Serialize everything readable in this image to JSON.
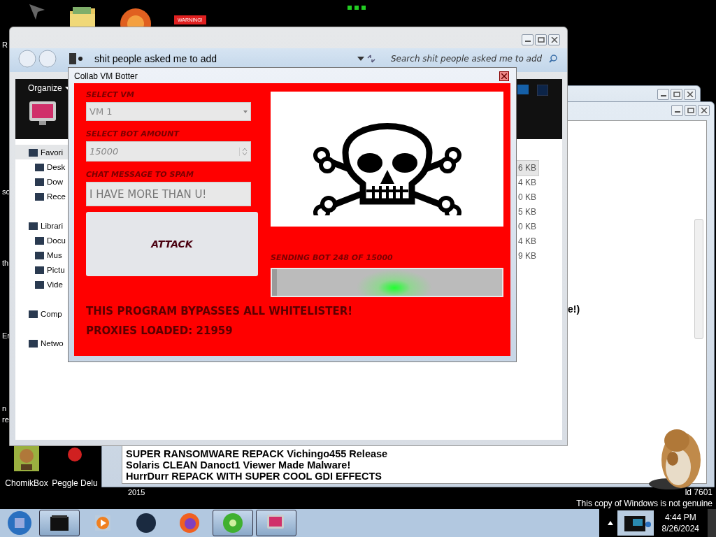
{
  "desktop": {
    "warning_label": "WARNING!",
    "edge_labels": [
      "R",
      "so",
      "th",
      "Er",
      "n",
      "re"
    ],
    "bottom_icons": [
      {
        "label": "ChomikBox",
        "kind": "box"
      },
      {
        "label": "Peggle Delu",
        "kind": "ball"
      }
    ],
    "year_label": "2015",
    "build_label": "ld 7601",
    "genuine_notice": "This copy of Windows is not genuine"
  },
  "back_window": {
    "partial_text": "e!)",
    "lines": [
      "SUPER RANSOMWARE REPACK Vichingo455 Release",
      "Solaris CLEAN Danoct1 Viewer Made Malware!",
      "HurrDurr REPACK WITH SUPER COOL GDI EFFECTS"
    ]
  },
  "explorer": {
    "address": "shit people asked me to add",
    "search_placeholder": "Search shit people asked me to add",
    "organize": "Organize",
    "nav": [
      {
        "label": "Favori",
        "selected": true,
        "children": [
          {
            "label": "Desk",
            "selected": false
          },
          {
            "label": "Dow",
            "selected": false
          },
          {
            "label": "Rece",
            "selected": false
          }
        ]
      },
      {
        "label": "Librari",
        "selected": false,
        "children": [
          {
            "label": "Docu",
            "selected": false
          },
          {
            "label": "Mus",
            "selected": false
          },
          {
            "label": "Pictu",
            "selected": false
          },
          {
            "label": "Vide",
            "selected": false
          }
        ]
      },
      {
        "label": "Comp",
        "selected": false
      },
      {
        "label": "Netwo",
        "selected": false
      }
    ],
    "sizes": [
      {
        "text": "6 KB",
        "selected": true
      },
      {
        "text": "4 KB",
        "selected": false
      },
      {
        "text": "0 KB",
        "selected": false
      },
      {
        "text": "5 KB",
        "selected": false
      },
      {
        "text": "0 KB",
        "selected": false
      },
      {
        "text": "4 KB",
        "selected": false
      },
      {
        "text": "9 KB",
        "selected": false
      }
    ]
  },
  "dialog": {
    "title": "Collab VM Botter",
    "vm_label": "SELECT VM",
    "vm_value": "VM 1",
    "amount_label": "SELECT BOT AMOUNT",
    "amount_value": "15000",
    "message_label": "CHAT MESSAGE TO SPAM",
    "message_value": "I HAVE MORE THAN U!",
    "attack": "ATTACK",
    "status": "SENDING BOT 248 OF 15000",
    "progress": {
      "level": 0.02
    },
    "note": "THIS PROGRAM BYPASSES ALL WHITELISTER!",
    "proxies": "PROXIES LOADED: 21959"
  },
  "taskbar": {
    "items": [
      {
        "kind": "box",
        "active": true
      },
      {
        "kind": "media",
        "active": false
      },
      {
        "kind": "globe",
        "active": false
      },
      {
        "kind": "firefox",
        "active": false
      },
      {
        "kind": "green-disc",
        "active": true
      },
      {
        "kind": "monitor",
        "active": true
      }
    ],
    "time": "4:44 PM",
    "date": "8/26/2024"
  }
}
